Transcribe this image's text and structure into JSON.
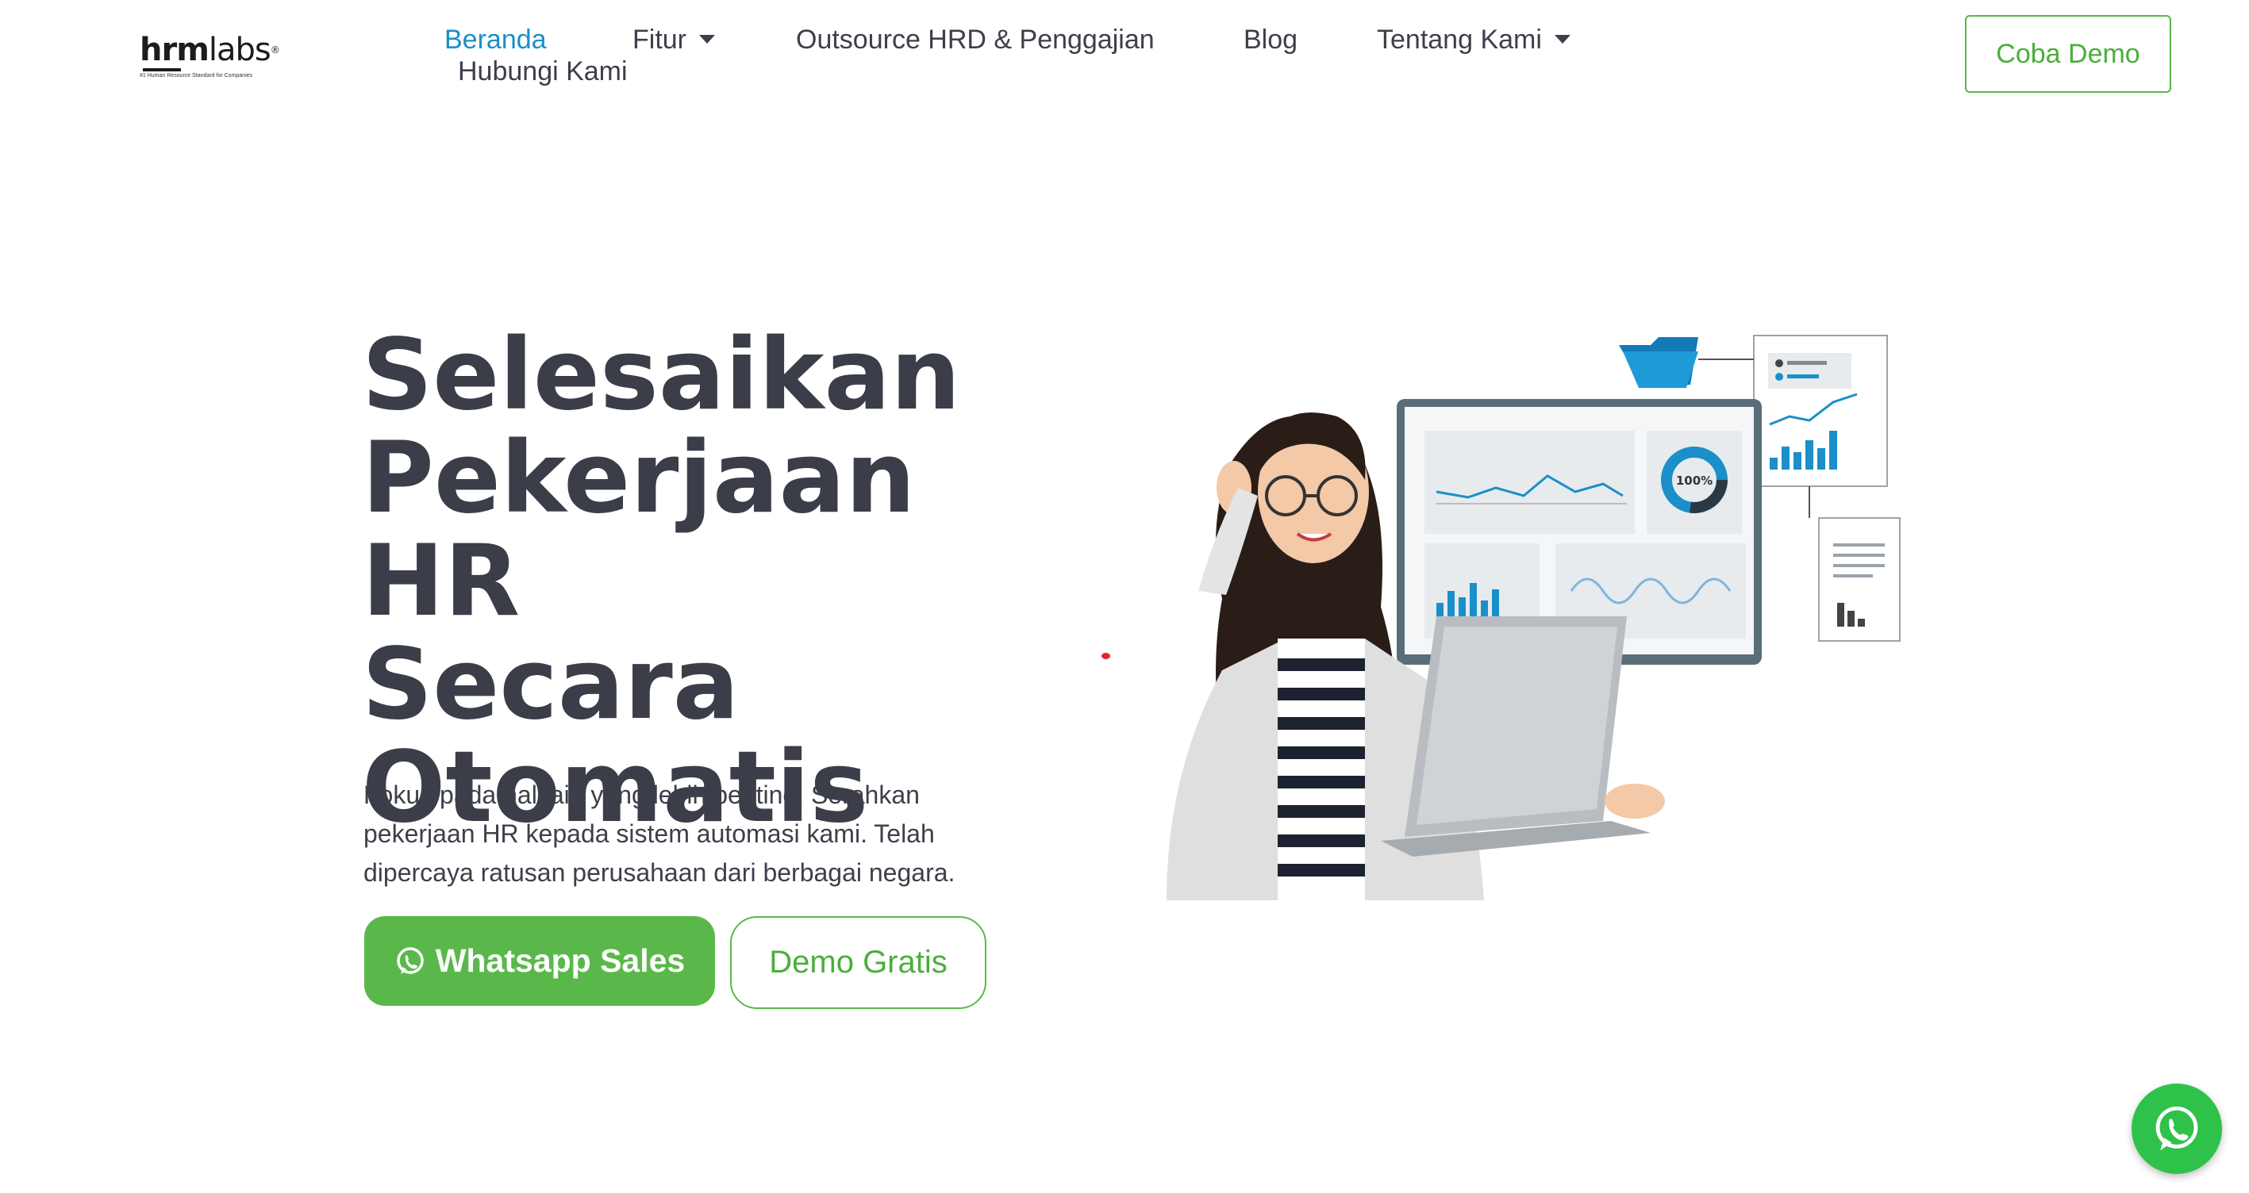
{
  "logo": {
    "text_light": "hrm",
    "text_rest": "labs",
    "tagline": "#1 Human Resource Standard for Companies"
  },
  "nav": {
    "items": [
      {
        "label": "Beranda",
        "active": true
      },
      {
        "label": "Fitur",
        "dropdown": true
      },
      {
        "label": "Outsource HRD & Penggajian"
      },
      {
        "label": "Blog"
      },
      {
        "label": "Tentang Kami",
        "dropdown": true
      },
      {
        "label": "Hubungi Kami"
      }
    ],
    "cta_label": "Coba Demo"
  },
  "hero": {
    "title_lines": [
      "Selesaikan",
      "Pekerjaan HR",
      "Secara",
      "Otomatis"
    ],
    "description_lines": [
      "Fokus pada hal lain yang lebih penting. Serahkan",
      "pekerjaan HR kepada sistem automasi kami. Telah",
      "dipercaya ratusan perusahaan dari berbagai negara."
    ],
    "whatsapp_label": "Whatsapp Sales",
    "demo_label": "Demo Gratis",
    "donut_label": "100%"
  },
  "colors": {
    "accent_green": "#5ab84a",
    "active_nav_blue": "#1a8fc9",
    "whatsapp_green": "#2fc24a",
    "chart_blue": "#1a8fc9",
    "text_dark": "#3b3d48"
  },
  "icons": [
    "whatsapp-icon",
    "caret-down-icon",
    "folder-icon",
    "document-icon"
  ]
}
